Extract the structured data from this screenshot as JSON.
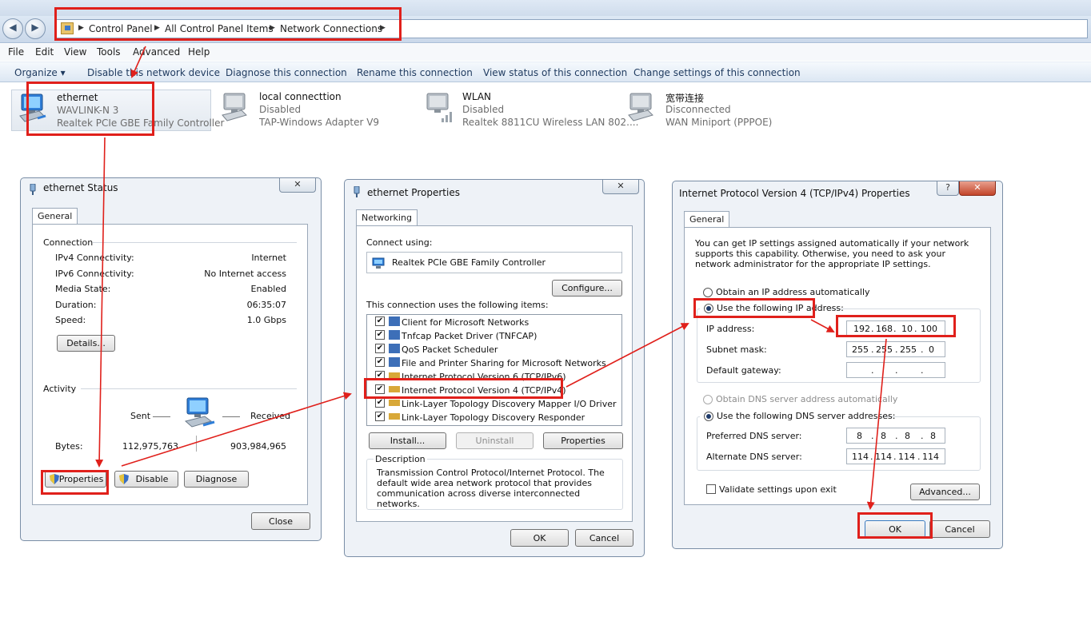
{
  "breadcrumbs": [
    "Control Panel",
    "All Control Panel Items",
    "Network Connections"
  ],
  "menu": [
    "File",
    "Edit",
    "View",
    "Tools",
    "Advanced",
    "Help"
  ],
  "commands": [
    "Organize ▾",
    "Disable this network device",
    "Diagnose this connection",
    "Rename this connection",
    "View status of this connection",
    "Change settings of this connection"
  ],
  "connections": [
    {
      "name": "ethernet",
      "status": "WAVLINK-N  3",
      "device": "Realtek PCIe GBE Family Controller"
    },
    {
      "name": "local connecttion",
      "status": "Disabled",
      "device": "TAP-Windows Adapter V9"
    },
    {
      "name": "WLAN",
      "status": "Disabled",
      "device": "Realtek 8811CU Wireless LAN 802...."
    },
    {
      "name": "宽带连接",
      "status": "Disconnected",
      "device": "WAN Miniport (PPPOE)"
    }
  ],
  "status_dialog": {
    "title": "ethernet Status",
    "close_glyph": "✕",
    "tab": "General",
    "connection_label": "Connection",
    "rows": [
      {
        "label": "IPv4 Connectivity:",
        "value": "Internet"
      },
      {
        "label": "IPv6 Connectivity:",
        "value": "No Internet access"
      },
      {
        "label": "Media State:",
        "value": "Enabled"
      },
      {
        "label": "Duration:",
        "value": "06:35:07"
      },
      {
        "label": "Speed:",
        "value": "1.0 Gbps"
      }
    ],
    "details_button": "Details...",
    "activity_label": "Activity",
    "sent_label": "Sent",
    "received_label": "Received",
    "bytes_label": "Bytes:",
    "bytes_sent": "112,975,763",
    "bytes_received": "903,984,965",
    "properties_button": "Properties",
    "disable_button": "Disable",
    "diagnose_button": "Diagnose",
    "close_button": "Close"
  },
  "properties_dialog": {
    "title": "ethernet Properties",
    "close_glyph": "✕",
    "tab": "Networking",
    "connect_using_label": "Connect using:",
    "adapter": "Realtek PCIe GBE Family Controller",
    "configure_button": "Configure...",
    "items_label": "This connection uses the following items:",
    "items": [
      "Client for Microsoft Networks",
      "Tnfcap Packet Driver (TNFCAP)",
      "QoS Packet Scheduler",
      "File and Printer Sharing for Microsoft Networks",
      "Internet Protocol Version 6 (TCP/IPv6)",
      "Internet Protocol Version 4 (TCP/IPv4)",
      "Link-Layer Topology Discovery Mapper I/O Driver",
      "Link-Layer Topology Discovery Responder"
    ],
    "install_button": "Install...",
    "uninstall_button": "Uninstall",
    "properties_button": "Properties",
    "description_label": "Description",
    "description": "Transmission Control Protocol/Internet Protocol. The default wide area network protocol that provides communication across diverse interconnected networks.",
    "ok_button": "OK",
    "cancel_button": "Cancel"
  },
  "ipv4_dialog": {
    "title": "Internet Protocol Version 4 (TCP/IPv4) Properties",
    "help_glyph": "?",
    "close_glyph": "✕",
    "tab": "General",
    "intro": "You can get IP settings assigned automatically if your network supports this capability. Otherwise, you need to ask your network administrator for the appropriate IP settings.",
    "obtain_ip_auto": "Obtain an IP address automatically",
    "use_following_ip": "Use the following IP address:",
    "ip_address_label": "IP address:",
    "ip_address": [
      "192",
      "168",
      "10",
      "100"
    ],
    "subnet_mask_label": "Subnet mask:",
    "subnet_mask": [
      "255",
      "255",
      "255",
      "0"
    ],
    "default_gateway_label": "Default gateway:",
    "default_gateway": [
      "",
      "",
      "",
      ""
    ],
    "obtain_dns_auto": "Obtain DNS server address automatically",
    "use_following_dns": "Use the following DNS server addresses:",
    "preferred_dns_label": "Preferred DNS server:",
    "preferred_dns": [
      "8",
      "8",
      "8",
      "8"
    ],
    "alternate_dns_label": "Alternate DNS server:",
    "alternate_dns": [
      "114",
      "114",
      "114",
      "114"
    ],
    "validate_label": "Validate settings upon exit",
    "advanced_button": "Advanced...",
    "ok_button": "OK",
    "cancel_button": "Cancel"
  },
  "colors": {
    "highlight": "#e0201b",
    "window": "#eef2f7",
    "chrome": "#dde8f4"
  }
}
